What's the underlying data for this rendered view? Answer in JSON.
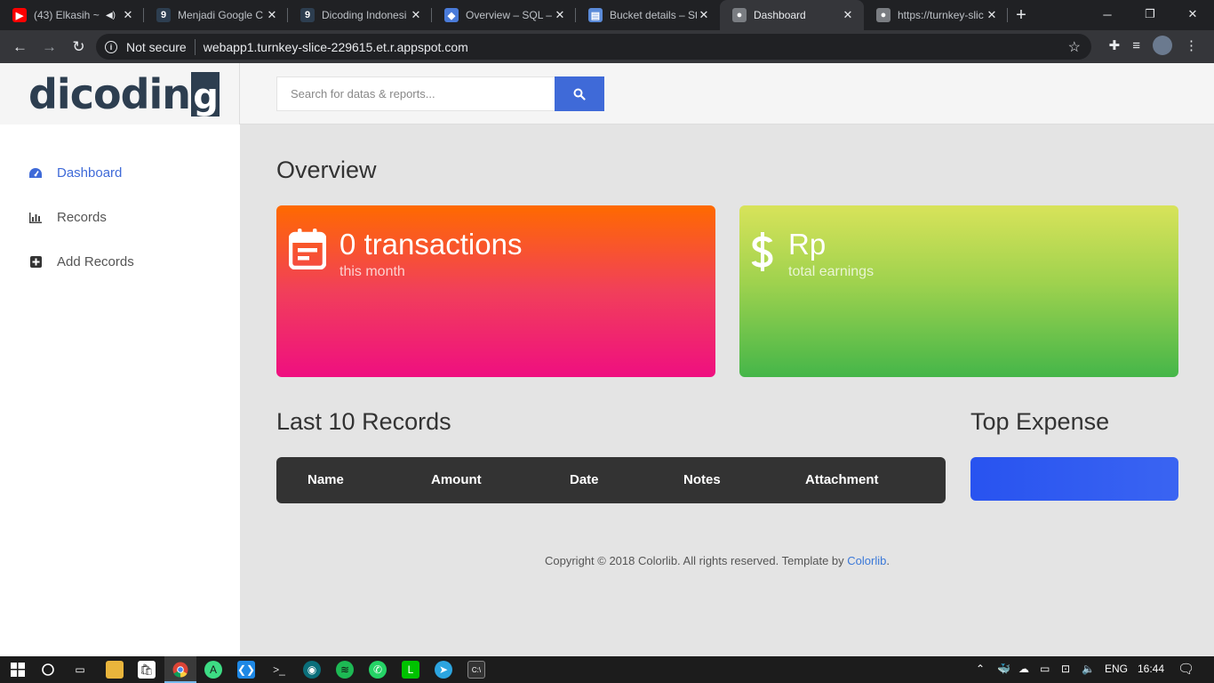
{
  "browser": {
    "tabs": [
      {
        "title": "(43) Elkasih ~ ",
        "favicon": "youtube-icon",
        "color": "#ff0000",
        "glyph": "▶",
        "audio": true,
        "active": false
      },
      {
        "title": "Menjadi Google C",
        "favicon": "dicoding-icon",
        "color": "#2d3e50",
        "glyph": "9",
        "audio": false,
        "active": false
      },
      {
        "title": "Dicoding Indonesi",
        "favicon": "dicoding-icon",
        "color": "#2d3e50",
        "glyph": "9",
        "audio": false,
        "active": false
      },
      {
        "title": "Overview – SQL – ",
        "favicon": "gcp-sql-icon",
        "color": "#4a7bd9",
        "glyph": "◆",
        "audio": false,
        "active": false
      },
      {
        "title": "Bucket details – St",
        "favicon": "gcp-storage-icon",
        "color": "#5a8ad8",
        "glyph": "▤",
        "audio": false,
        "active": false
      },
      {
        "title": "Dashboard",
        "favicon": "globe-icon",
        "color": "#7a7d82",
        "glyph": "●",
        "audio": false,
        "active": true
      },
      {
        "title": "https://turnkey-slic",
        "favicon": "globe-icon",
        "color": "#7a7d82",
        "glyph": "●",
        "audio": false,
        "active": false
      }
    ],
    "omnibox": {
      "security_label": "Not secure",
      "url": "webapp1.turnkey-slice-229615.et.r.appspot.com"
    }
  },
  "app": {
    "logo_text": "dicodin",
    "logo_g": "g",
    "search": {
      "placeholder": "Search for datas & reports..."
    },
    "nav": [
      {
        "label": "Dashboard",
        "icon": "dashboard-gauge-icon",
        "active": true
      },
      {
        "label": "Records",
        "icon": "bar-chart-icon",
        "active": false
      },
      {
        "label": "Add Records",
        "icon": "plus-square-icon",
        "active": false
      }
    ],
    "overview_title": "Overview",
    "cards": {
      "transactions": {
        "value": "0 transactions",
        "caption": "this month"
      },
      "earnings": {
        "value": "Rp",
        "caption": "total earnings"
      }
    },
    "last_records": {
      "title": "Last 10 Records",
      "columns": [
        "Name",
        "Amount",
        "Date",
        "Notes",
        "Attachment"
      ]
    },
    "top_expense": {
      "title": "Top Expense"
    },
    "footer": {
      "text": "Copyright © 2018 Colorlib. All rights reserved. Template by ",
      "link": "Colorlib",
      "suffix": "."
    }
  },
  "taskbar": {
    "language": "ENG",
    "time": "16:44"
  }
}
